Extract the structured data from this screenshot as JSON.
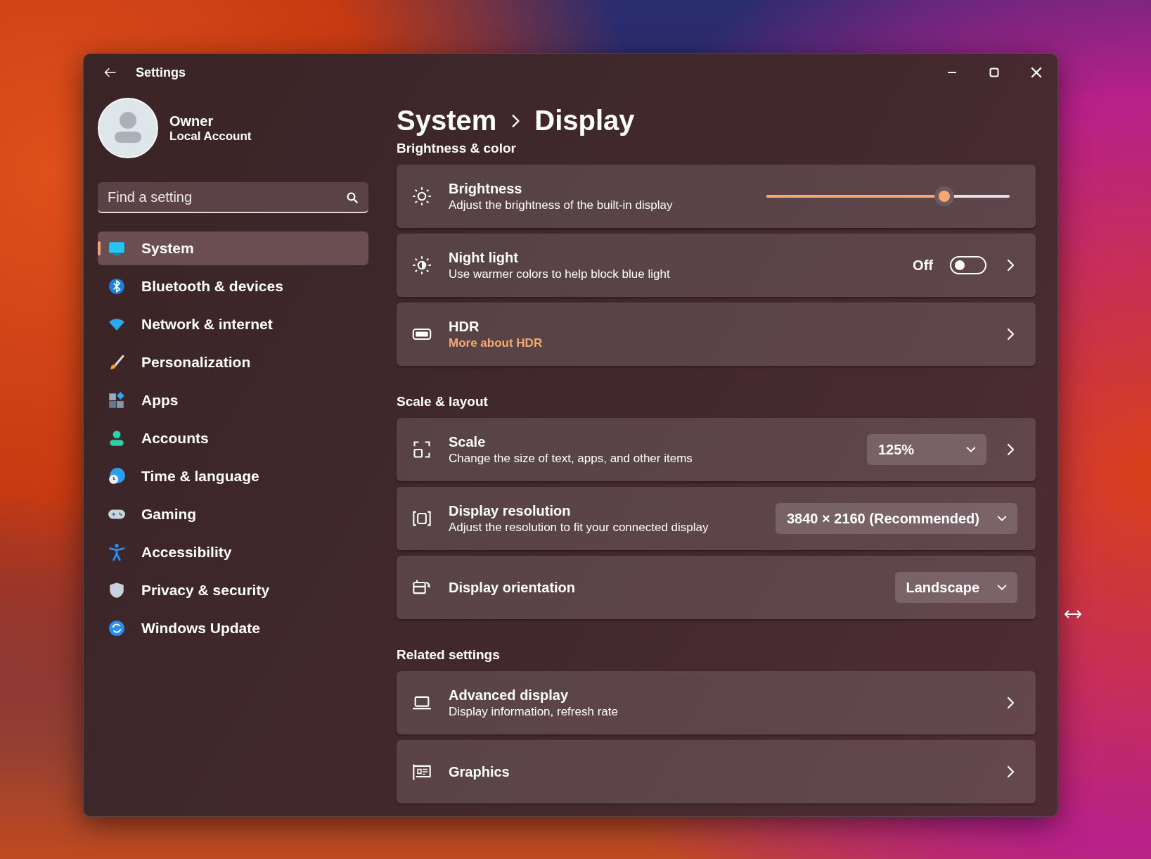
{
  "window": {
    "title": "Settings"
  },
  "profile": {
    "name": "Owner",
    "account": "Local Account"
  },
  "search": {
    "placeholder": "Find a setting"
  },
  "sidebar": {
    "items": [
      {
        "label": "System",
        "selected": true
      },
      {
        "label": "Bluetooth & devices",
        "selected": false
      },
      {
        "label": "Network & internet",
        "selected": false
      },
      {
        "label": "Personalization",
        "selected": false
      },
      {
        "label": "Apps",
        "selected": false
      },
      {
        "label": "Accounts",
        "selected": false
      },
      {
        "label": "Time & language",
        "selected": false
      },
      {
        "label": "Gaming",
        "selected": false
      },
      {
        "label": "Accessibility",
        "selected": false
      },
      {
        "label": "Privacy & security",
        "selected": false
      },
      {
        "label": "Windows Update",
        "selected": false
      }
    ]
  },
  "breadcrumb": [
    "System",
    "Display"
  ],
  "sections": [
    {
      "title": "Brightness & color",
      "cards": [
        {
          "kind": "slider",
          "title": "Brightness",
          "subtitle": "Adjust the brightness of the built-in display",
          "level": 0.73
        },
        {
          "kind": "toggle",
          "title": "Night light",
          "subtitle": "Use warmer colors to help block blue light",
          "state_label": "Off",
          "on": false
        },
        {
          "kind": "link",
          "title": "HDR",
          "link": "More about HDR"
        }
      ]
    },
    {
      "title": "Scale & layout",
      "cards": [
        {
          "kind": "dropdown",
          "title": "Scale",
          "subtitle": "Change the size of text, apps, and other items",
          "value": "125%",
          "chevron": true
        },
        {
          "kind": "dropdown",
          "title": "Display resolution",
          "subtitle": "Adjust the resolution to fit your connected display",
          "value": "3840 × 2160 (Recommended)",
          "chevron": false
        },
        {
          "kind": "dropdown",
          "title": "Display orientation",
          "value": "Landscape",
          "chevron": false
        }
      ]
    },
    {
      "title": "Related settings",
      "cards": [
        {
          "kind": "nav",
          "title": "Advanced display",
          "subtitle": "Display information, refresh rate"
        },
        {
          "kind": "nav",
          "title": "Graphics"
        }
      ]
    }
  ]
}
